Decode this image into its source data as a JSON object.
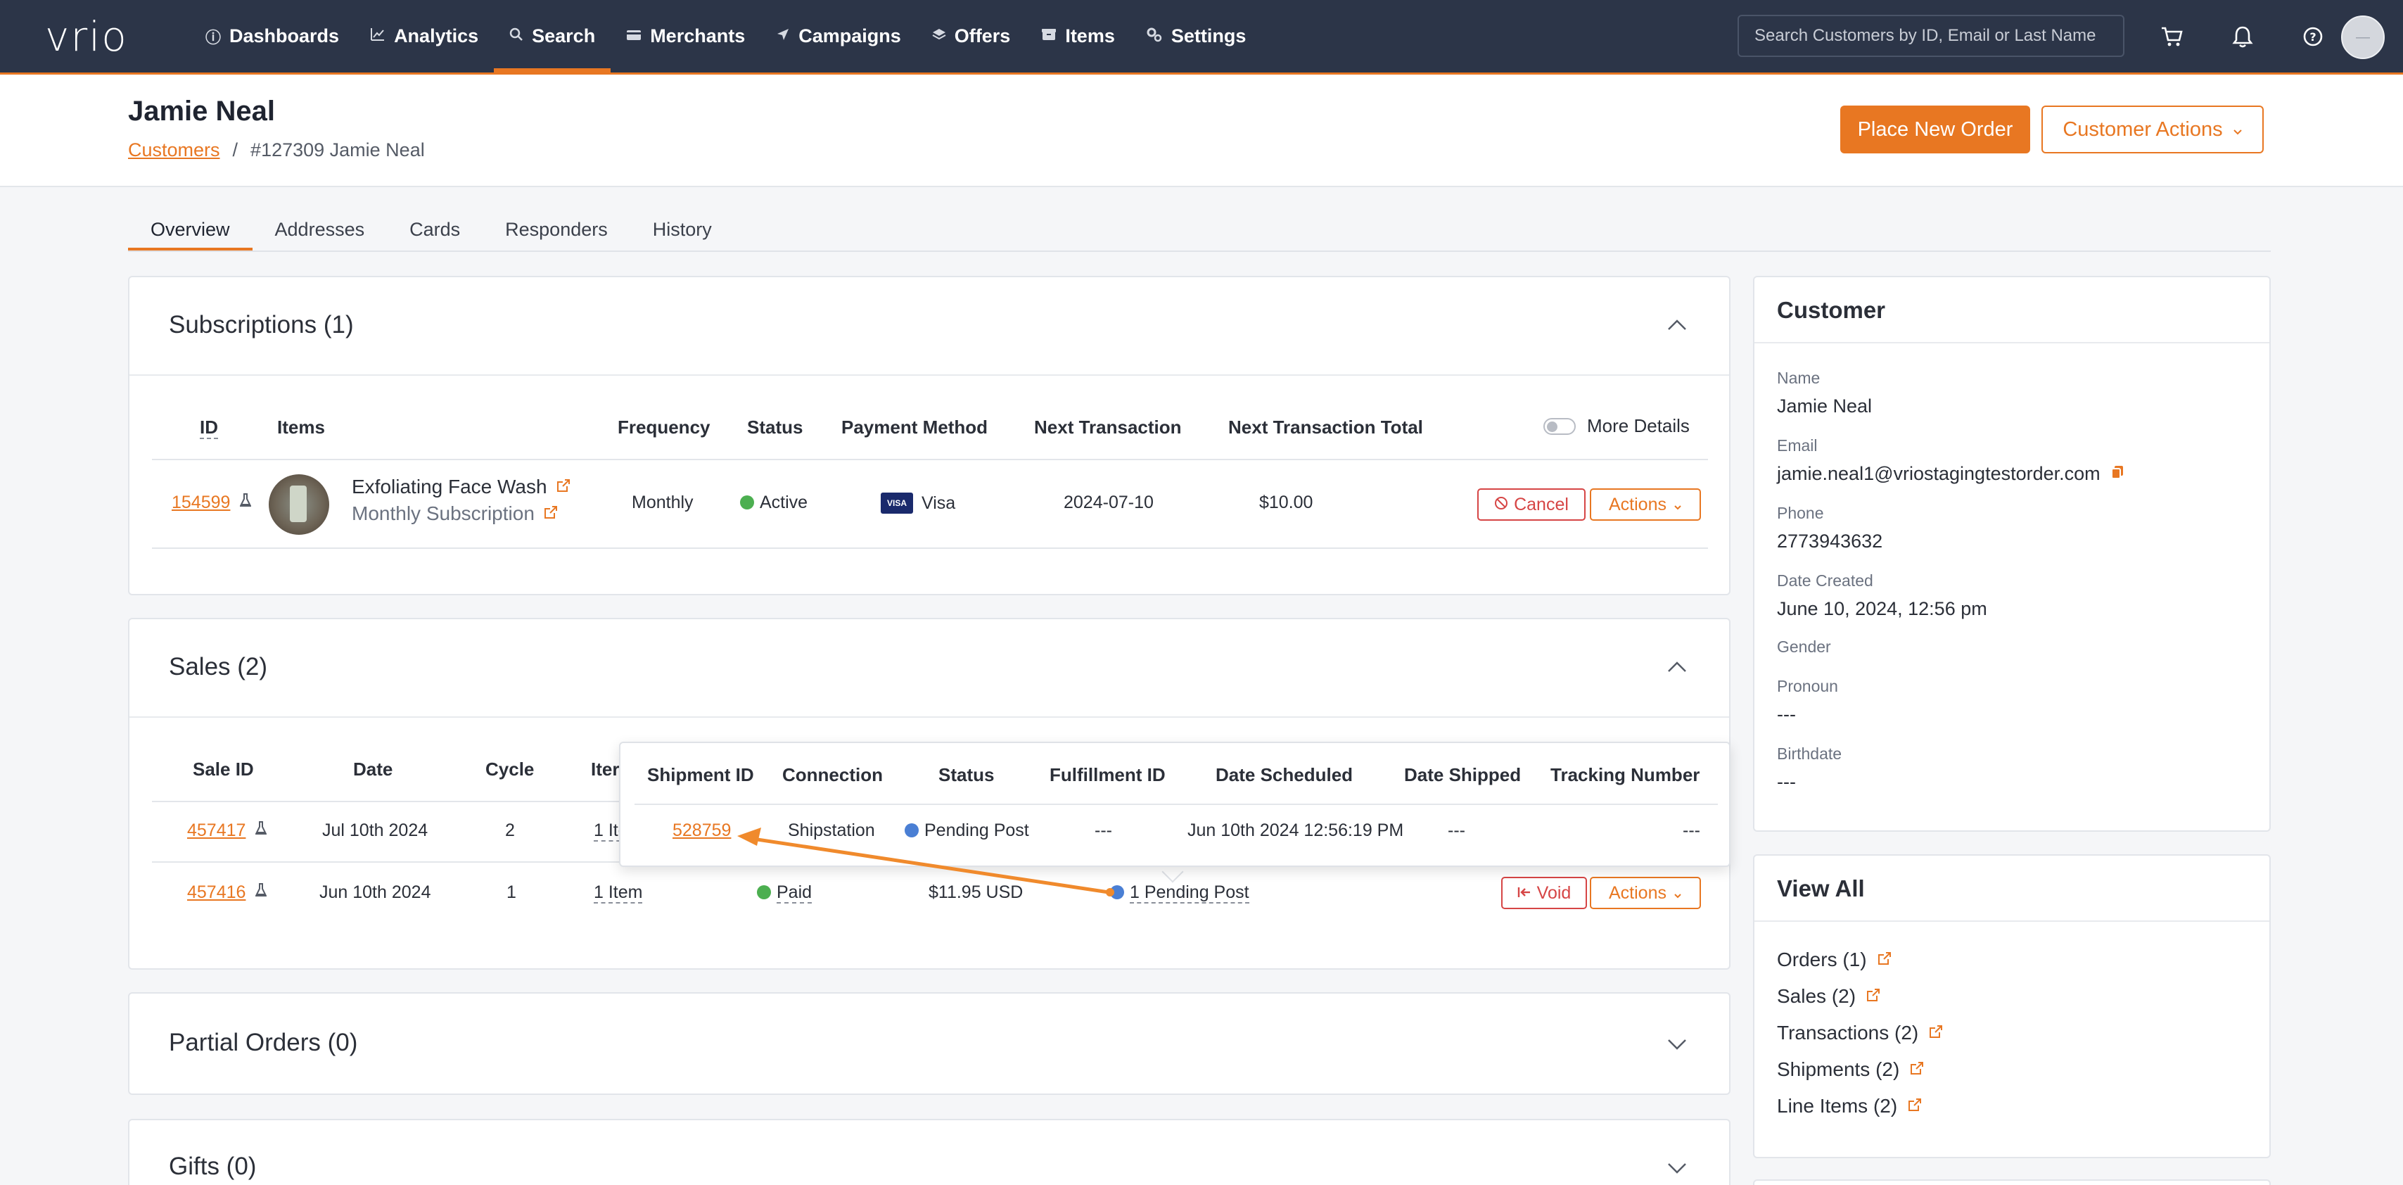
{
  "app": {
    "logo": "vrio",
    "nav": [
      {
        "label": "Dashboards",
        "icon": "info-circle-icon"
      },
      {
        "label": "Analytics",
        "icon": "chart-line-icon"
      },
      {
        "label": "Search",
        "icon": "search-icon"
      },
      {
        "label": "Merchants",
        "icon": "credit-card-icon"
      },
      {
        "label": "Campaigns",
        "icon": "send-icon"
      },
      {
        "label": "Offers",
        "icon": "layers-icon"
      },
      {
        "label": "Items",
        "icon": "box-icon"
      },
      {
        "label": "Settings",
        "icon": "gears-icon"
      }
    ],
    "active_nav": "Search",
    "search_placeholder": "Search Customers by ID, Email or Last Name"
  },
  "header": {
    "title": "Jamie Neal",
    "breadcrumb_root": "Customers",
    "breadcrumb_sep": "/",
    "breadcrumb_current": "#127309 Jamie Neal",
    "place_order": "Place New Order",
    "customer_actions": "Customer Actions"
  },
  "tabs": [
    "Overview",
    "Addresses",
    "Cards",
    "Responders",
    "History"
  ],
  "subscriptions": {
    "title": "Subscriptions (1)",
    "columns": [
      "ID",
      "Items",
      "Frequency",
      "Status",
      "Payment Method",
      "Next Transaction",
      "Next Transaction Total"
    ],
    "more_details": "More Details",
    "row": {
      "id": "154599",
      "item_name": "Exfoliating Face Wash",
      "item_sub": "Monthly Subscription",
      "frequency": "Monthly",
      "status": "Active",
      "card_brand": "VISA",
      "payment": "Visa",
      "next_transaction": "2024-07-10",
      "next_total": "$10.00",
      "cancel": "Cancel",
      "actions": "Actions"
    }
  },
  "sales": {
    "title": "Sales (2)",
    "columns": [
      "Sale ID",
      "Date",
      "Cycle",
      "Iter"
    ],
    "rows": [
      {
        "id": "457417",
        "date": "Jul 10th 2024",
        "cycle": "2",
        "items": "1 Ite"
      },
      {
        "id": "457416",
        "date": "Jun 10th 2024",
        "cycle": "1",
        "items": "1 Item",
        "payment": "Paid",
        "total": "$11.95 USD",
        "shipment": "1 Pending Post",
        "void": "Void",
        "actions": "Actions"
      }
    ]
  },
  "shipment_popup": {
    "columns": [
      "Shipment ID",
      "Connection",
      "Status",
      "Fulfillment ID",
      "Date Scheduled",
      "Date Shipped",
      "Tracking Number"
    ],
    "row": {
      "id": "528759",
      "connection": "Shipstation",
      "status": "Pending Post",
      "fulfillment_id": "---",
      "date_scheduled": "Jun 10th 2024 12:56:19 PM",
      "date_shipped": "---",
      "tracking": "---"
    }
  },
  "partial_orders": {
    "title": "Partial Orders (0)"
  },
  "gifts": {
    "title": "Gifts (0)"
  },
  "customer": {
    "title": "Customer",
    "fields": [
      {
        "label": "Name",
        "value": "Jamie Neal"
      },
      {
        "label": "Email",
        "value": "jamie.neal1@vriostagingtestorder.com"
      },
      {
        "label": "Phone",
        "value": "2773943632"
      },
      {
        "label": "Date Created",
        "value": "June 10, 2024, 12:56 pm"
      },
      {
        "label": "Gender",
        "value": ""
      },
      {
        "label": "Pronoun",
        "value": "---"
      },
      {
        "label": "Birthdate",
        "value": "---"
      }
    ]
  },
  "view_all": {
    "title": "View All",
    "links": [
      "Orders (1)",
      "Sales (2)",
      "Transactions (2)",
      "Shipments (2)",
      "Line Items (2)"
    ]
  },
  "colors": {
    "accent": "#e87722",
    "nav_bg": "#2c3548",
    "active_dot": "#4caf50",
    "pending_dot": "#4a7fd4",
    "danger": "#d64545"
  }
}
